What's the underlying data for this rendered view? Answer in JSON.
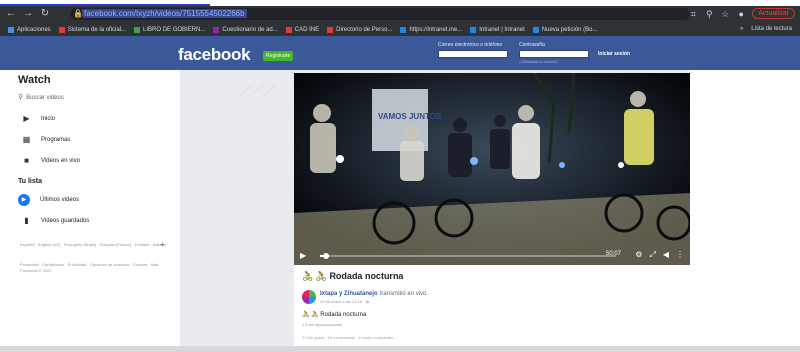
{
  "browser": {
    "url": "facebook.com/Ixyzh/videos/7515554502266b",
    "update_label": "Actualizar",
    "bookmarks": [
      {
        "label": "Aplicaciones",
        "color": "#4a90e2"
      },
      {
        "label": "Sistema de la oficial...",
        "color": "#e53935"
      },
      {
        "label": "LIBRO DE GOBIERN...",
        "color": "#43a047"
      },
      {
        "label": "Cuestionario de ad...",
        "color": "#8e24aa"
      },
      {
        "label": "CAD INE",
        "color": "#e53935"
      },
      {
        "label": "Directorio de Perso...",
        "color": "#e53935"
      },
      {
        "label": "https://intranet.ine...",
        "color": "#1e88e5"
      },
      {
        "label": "Intranet | Intranet",
        "color": "#1e88e5"
      },
      {
        "label": "Nueva petición (Bo...",
        "color": "#1e88e5"
      }
    ],
    "bookmarks_right": "Lista de lectura"
  },
  "header": {
    "logo": "facebook",
    "register": "Registrarte",
    "email_label": "Correo electrónico o teléfono",
    "password_label": "Contraseña",
    "forgot": "¿Olvidaste tu cuenta?",
    "login": "Iniciar sesión"
  },
  "sidebar": {
    "title": "Watch",
    "search_placeholder": "Buscar videos",
    "items": [
      {
        "label": "Inicio",
        "icon": "home-icon"
      },
      {
        "label": "Programas",
        "icon": "shows-icon"
      },
      {
        "label": "Videos en vivo",
        "icon": "live-icon"
      }
    ],
    "list_title": "Tu lista",
    "list_items": [
      {
        "label": "Últimos videos",
        "icon": "play-circle-icon"
      },
      {
        "label": "Videos guardados",
        "icon": "saved-icon"
      }
    ],
    "languages": "Español · English (US) · Português (Brasil) · Français (France) · Deutsch · Italiano",
    "footer": "Privacidad · Condiciones · Publicidad · Opciones de anuncios · Cookies · Más · Facebook © 2021"
  },
  "video": {
    "time": "50:07",
    "progress": 0.02,
    "banner_text": "VAMOS JUNTOS"
  },
  "post": {
    "title": "Rodada nocturna",
    "page_name": "Ixtapa y Zihuatanejo",
    "action": "transmitió en vivo.",
    "date": "23 de enero a las 22:18 ·",
    "text": "Rodada nocturna",
    "reactions": "1.4 mil reproducciones",
    "stats": "27 Me gusta · 15 comentarios · 8 veces compartido"
  },
  "colors": {
    "fb_blue": "#3b5998",
    "register_green": "#42b72a",
    "chrome_dark": "#2e3136"
  }
}
